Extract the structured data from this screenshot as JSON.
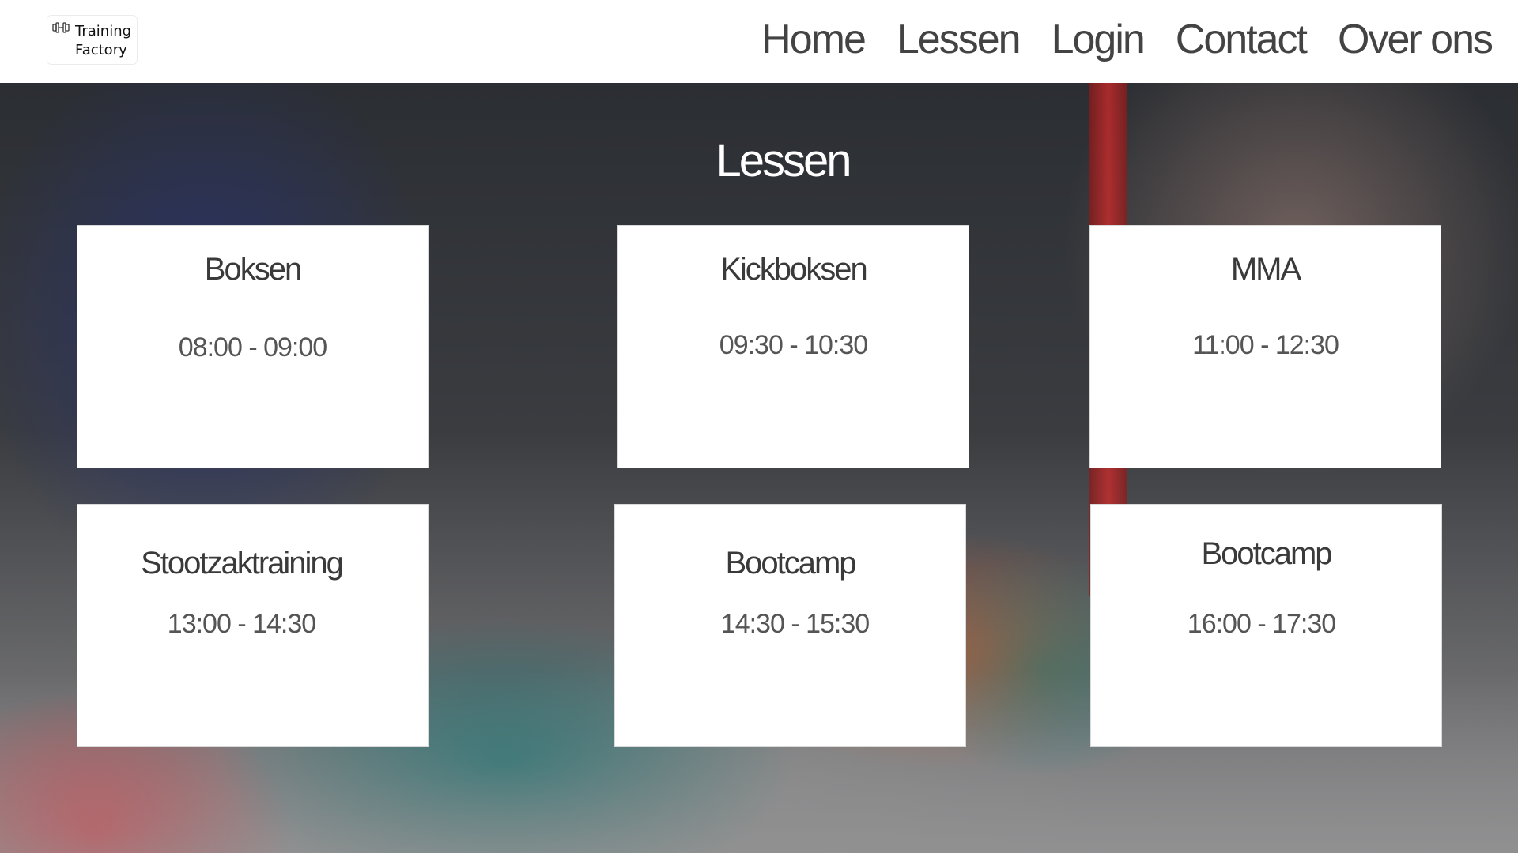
{
  "header": {
    "logo": {
      "line1": "Training",
      "line2": "Factory",
      "icon": "dumbbell-icon"
    },
    "nav": [
      {
        "label": "Home"
      },
      {
        "label": "Lessen"
      },
      {
        "label": "Login"
      },
      {
        "label": "Contact"
      },
      {
        "label": "Over ons"
      }
    ]
  },
  "main": {
    "title": "Lessen",
    "classes": [
      {
        "name": "Boksen",
        "time": "08:00 - 09:00"
      },
      {
        "name": "Kickboksen",
        "time": "09:30 - 10:30"
      },
      {
        "name": "MMA",
        "time": "11:00 - 12:30"
      },
      {
        "name": "Stootzaktraining",
        "time": "13:00 - 14:30"
      },
      {
        "name": "Bootcamp",
        "time": "14:30 - 15:30"
      },
      {
        "name": "Bootcamp",
        "time": "16:00 - 17:30"
      }
    ]
  }
}
